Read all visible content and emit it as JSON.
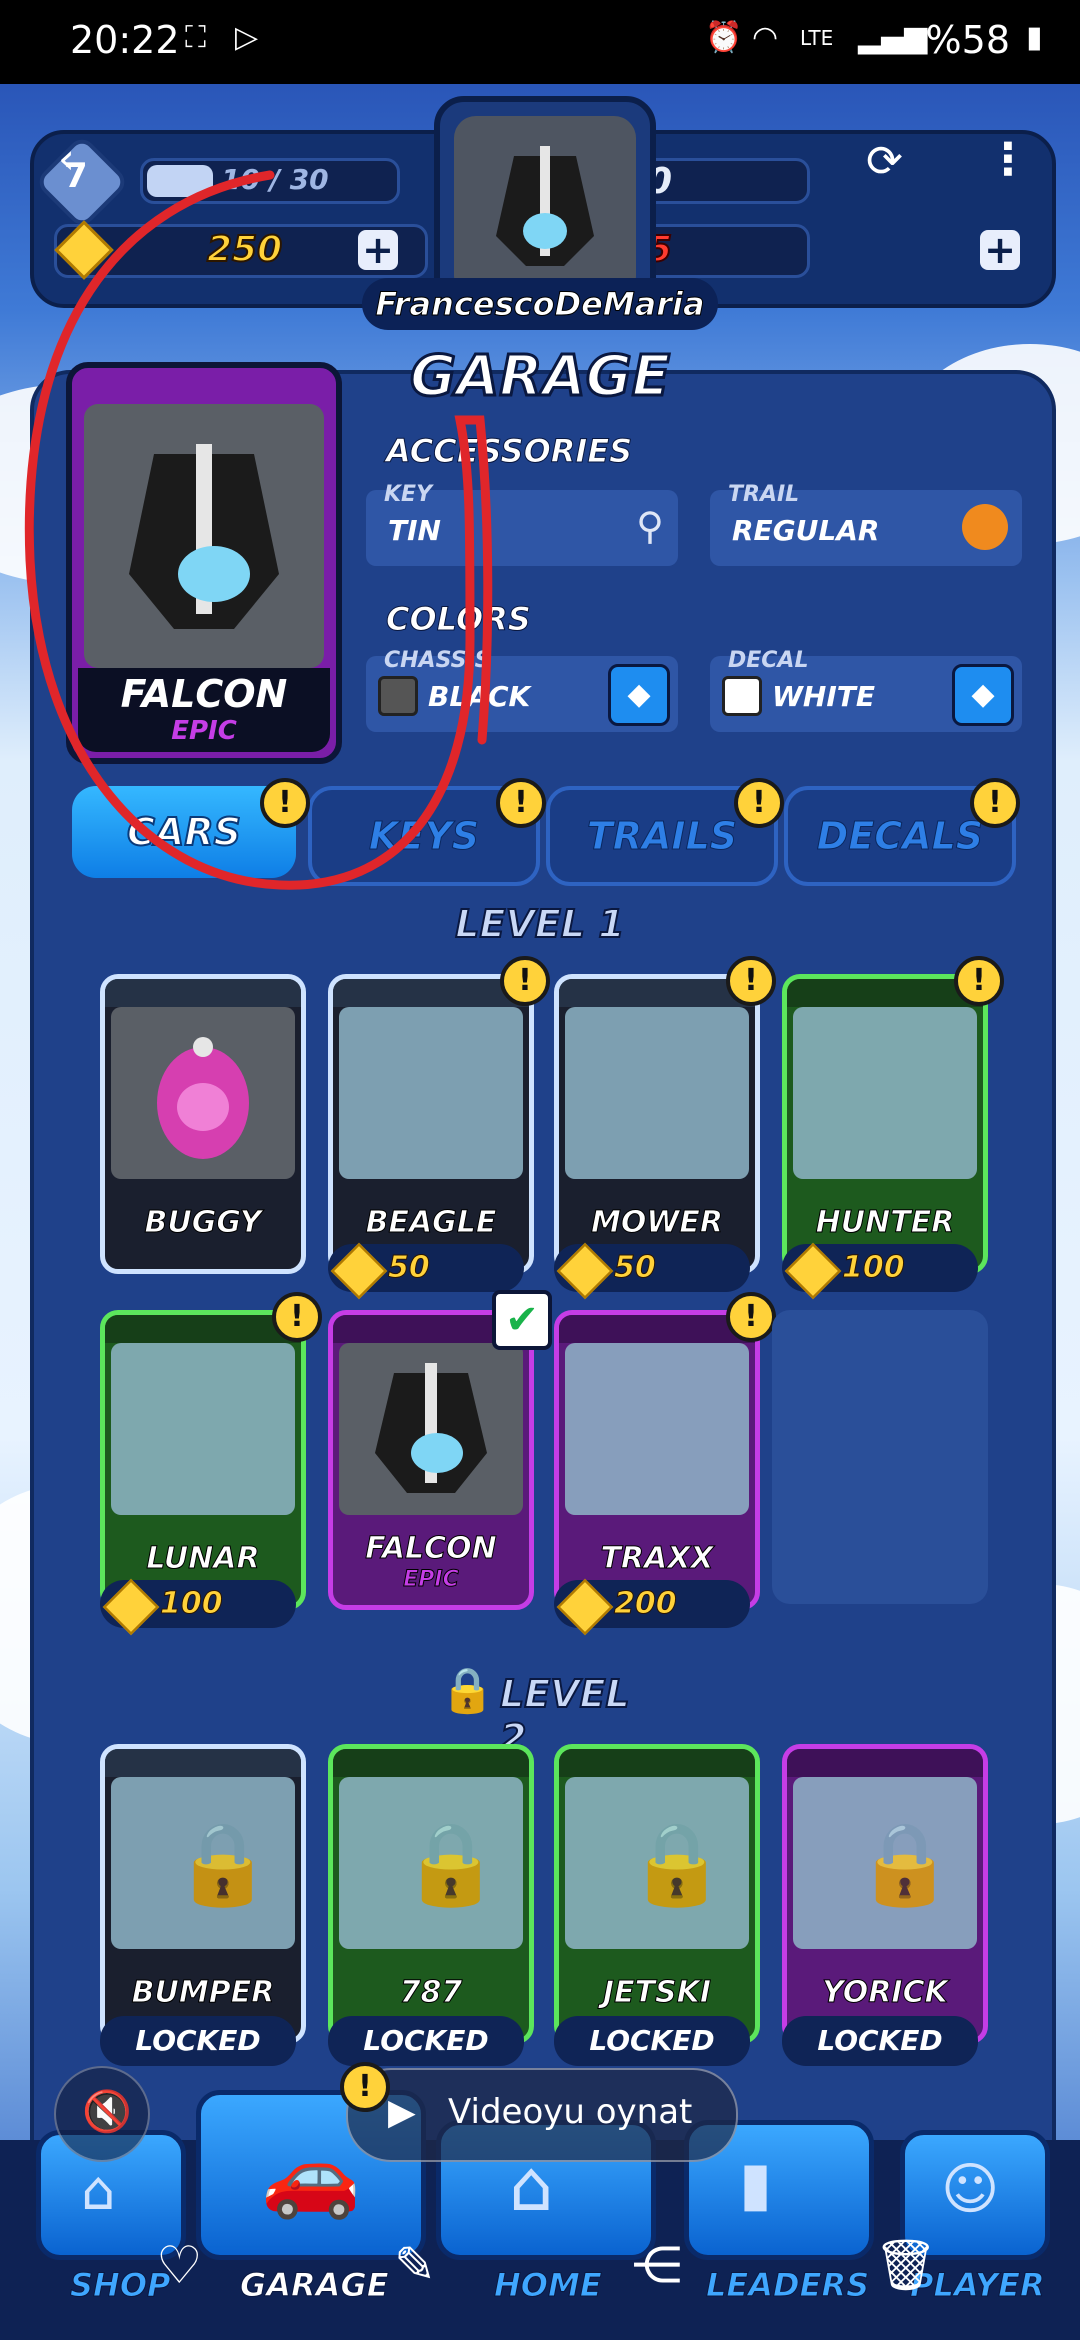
{
  "status_bar": {
    "time": "20:22",
    "battery": "%58",
    "network": "LTE"
  },
  "hud": {
    "level": "7",
    "xp_progress": "10 / 30",
    "coins": "250",
    "medals": "0",
    "gems": "5",
    "player_name": "FrancescoDeMaria"
  },
  "garage": {
    "title": "GARAGE",
    "selected_car": {
      "name": "FALCON",
      "rarity": "EPIC"
    },
    "accessories_label": "ACCESSORIES",
    "key": {
      "label": "KEY",
      "value": "TIN"
    },
    "trail": {
      "label": "TRAIL",
      "value": "REGULAR"
    },
    "colors_label": "COLORS",
    "chassis": {
      "label": "CHASSIS",
      "value": "BLACK"
    },
    "decal": {
      "label": "DECAL",
      "value": "WHITE"
    },
    "tabs": [
      "CARS",
      "KEYS",
      "TRAILS",
      "DECALS"
    ],
    "level1_title": "LEVEL 1",
    "level2_title": "LEVEL 2",
    "level1_cars": [
      {
        "name": "BUGGY",
        "price": ""
      },
      {
        "name": "BEAGLE",
        "price": "50"
      },
      {
        "name": "MOWER",
        "price": "50"
      },
      {
        "name": "HUNTER",
        "price": "100"
      },
      {
        "name": "LUNAR",
        "price": "100"
      },
      {
        "name": "FALCON",
        "rarity": "EPIC"
      },
      {
        "name": "TRAXX",
        "price": "200"
      }
    ],
    "level2_cars": [
      {
        "name": "BUMPER",
        "status": "LOCKED"
      },
      {
        "name": "787",
        "status": "LOCKED"
      },
      {
        "name": "JETSKI",
        "status": "LOCKED"
      },
      {
        "name": "YORICK",
        "status": "LOCKED"
      }
    ]
  },
  "overlay": {
    "video_label": "Videoyu oynat"
  },
  "nav": {
    "shop": "SHOP",
    "garage": "GARAGE",
    "home": "HOME",
    "leaders": "LEADERS",
    "player": "PLAYER"
  },
  "colors": {
    "accent_blue": "#1e8df0",
    "coin_gold": "#ffd23a",
    "epic_purple": "#c53de6",
    "annotation_red": "#e0262a"
  }
}
